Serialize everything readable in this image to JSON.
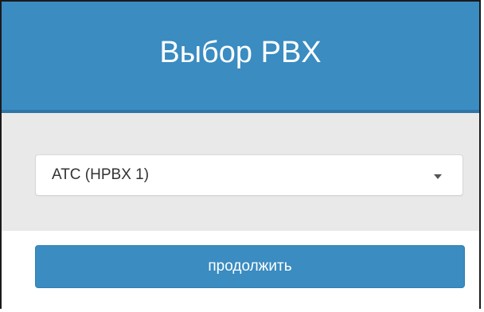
{
  "header": {
    "title": "Выбор PBX"
  },
  "pbx_select": {
    "selected_value": "АТС (HPBX 1)",
    "caret_icon": "chevron-down-icon"
  },
  "actions": {
    "continue_label": "продолжить"
  },
  "colors": {
    "header_bg": "#3a8cc1",
    "body_bg": "#e9e9e9",
    "button_bg": "#3a8cc1"
  }
}
